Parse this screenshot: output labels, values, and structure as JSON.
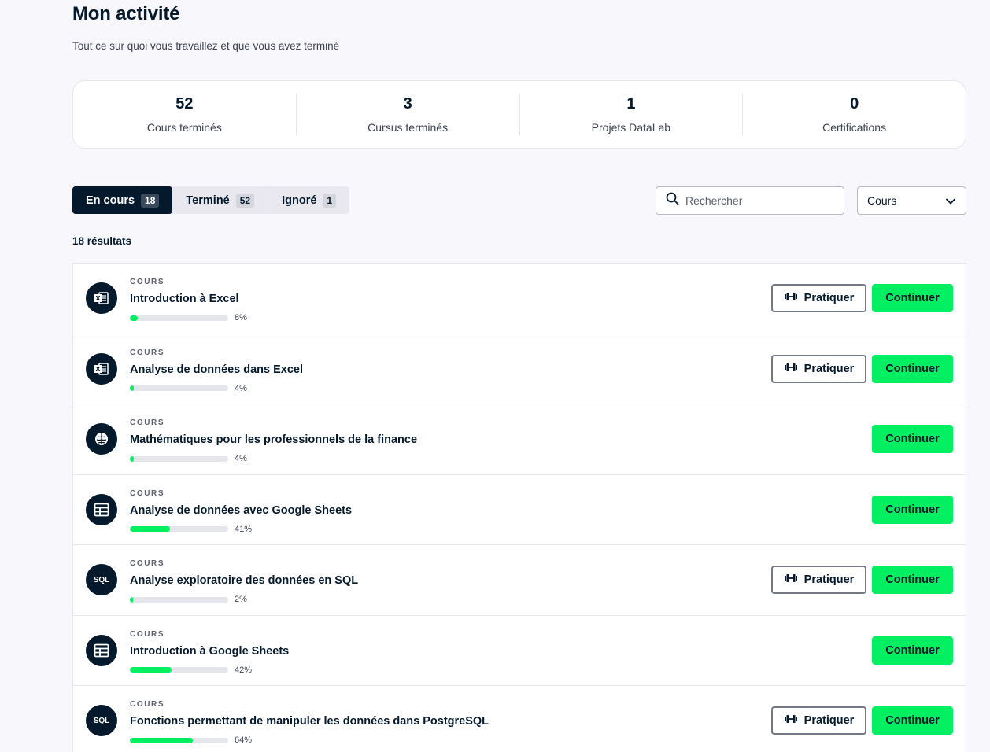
{
  "header": {
    "title": "Mon activité",
    "subtitle": "Tout ce sur quoi vous travaillez et que vous avez terminé"
  },
  "stats": [
    {
      "value": "52",
      "label": "Cours terminés"
    },
    {
      "value": "3",
      "label": "Cursus terminés"
    },
    {
      "value": "1",
      "label": "Projets DataLab"
    },
    {
      "value": "0",
      "label": "Certifications"
    }
  ],
  "tabs": [
    {
      "label": "En cours",
      "count": "18",
      "active": true
    },
    {
      "label": "Terminé",
      "count": "52",
      "active": false
    },
    {
      "label": "Ignoré",
      "count": "1",
      "active": false
    }
  ],
  "search": {
    "placeholder": "Rechercher",
    "icon": "search-icon"
  },
  "filter": {
    "selected": "Cours",
    "icon": "chevron-down-icon"
  },
  "results_label": "18 résultats",
  "colors": {
    "accent": "#03ef62",
    "navy": "#05192d"
  },
  "buttons": {
    "practice": "Pratiquer",
    "continue": "Continuer"
  },
  "courses": [
    {
      "type": "COURS",
      "title": "Introduction à Excel",
      "progress": "8%",
      "icon": "excel-icon",
      "practice": true
    },
    {
      "type": "COURS",
      "title": "Analyse de données dans Excel",
      "progress": "4%",
      "icon": "excel-icon",
      "practice": true
    },
    {
      "type": "COURS",
      "title": "Mathématiques pour les professionnels de la finance",
      "progress": "4%",
      "icon": "brain-icon",
      "practice": false
    },
    {
      "type": "COURS",
      "title": "Analyse de données avec Google Sheets",
      "progress": "41%",
      "icon": "spreadsheet-icon",
      "practice": false
    },
    {
      "type": "COURS",
      "title": "Analyse exploratoire des données en SQL",
      "progress": "2%",
      "icon": "sql-icon",
      "icon_text": "SQL",
      "practice": true
    },
    {
      "type": "COURS",
      "title": "Introduction à Google Sheets",
      "progress": "42%",
      "icon": "spreadsheet-icon",
      "practice": false
    },
    {
      "type": "COURS",
      "title": "Fonctions permettant de manipuler les données dans PostgreSQL",
      "progress": "64%",
      "icon": "sql-icon",
      "icon_text": "SQL",
      "practice": true
    }
  ]
}
